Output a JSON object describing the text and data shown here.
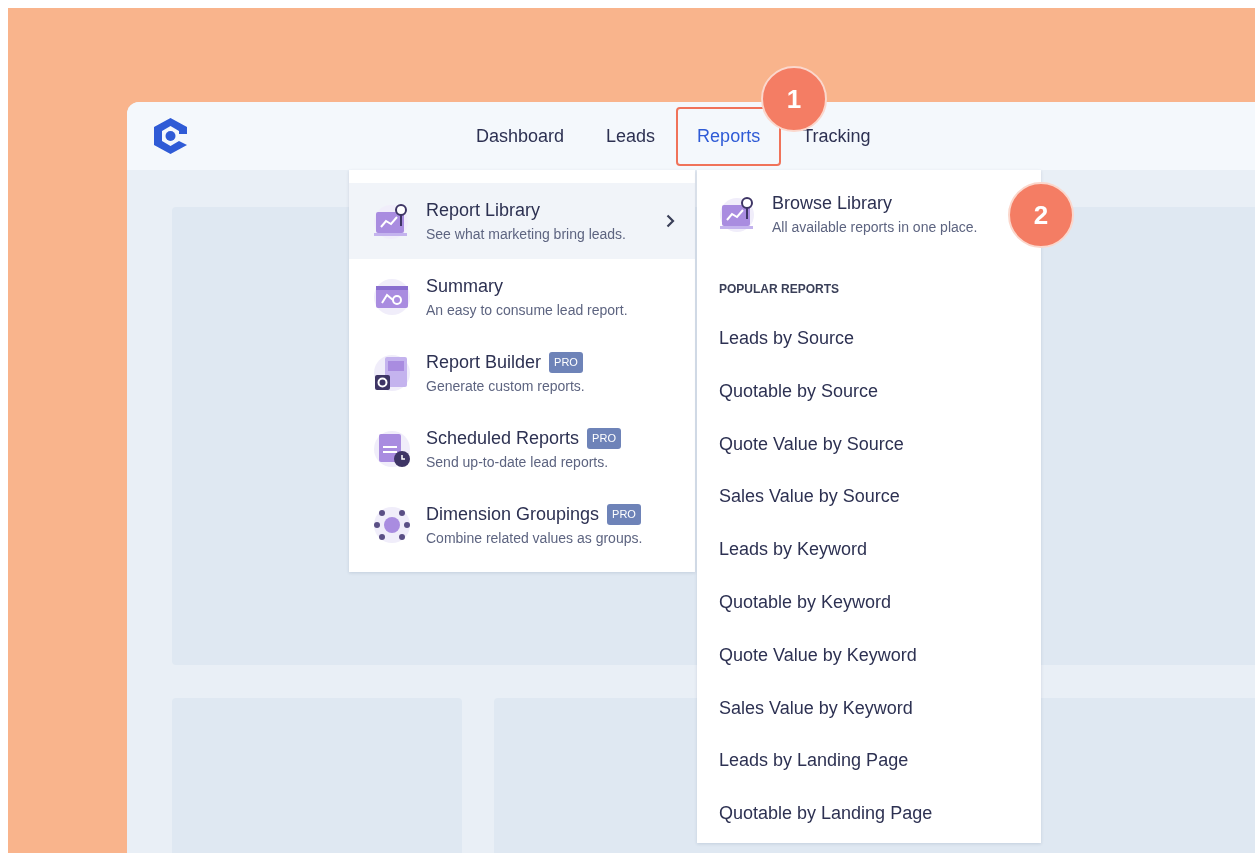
{
  "nav": {
    "items": [
      {
        "label": "Dashboard",
        "selected": false
      },
      {
        "label": "Leads",
        "selected": false
      },
      {
        "label": "Reports",
        "selected": true
      },
      {
        "label": "Tracking",
        "selected": false
      }
    ]
  },
  "menu": {
    "items": [
      {
        "title": "Report Library",
        "description": "See what marketing bring leads.",
        "selected": true,
        "has_submenu": true
      },
      {
        "title": "Summary",
        "description": "An easy to consume lead report.",
        "selected": false,
        "has_submenu": false
      },
      {
        "title": "Report Builder",
        "description": "Generate custom reports.",
        "badge": "PRO",
        "selected": false,
        "has_submenu": false
      },
      {
        "title": "Scheduled Reports",
        "description": "Send up-to-date lead reports.",
        "badge": "PRO",
        "selected": false,
        "has_submenu": false
      },
      {
        "title": "Dimension Groupings",
        "description": "Combine related values as groups.",
        "badge": "PRO",
        "selected": false,
        "has_submenu": false
      }
    ]
  },
  "submenu": {
    "header": {
      "title": "Browse Library",
      "description": "All available reports in one place."
    },
    "section_label": "POPULAR REPORTS",
    "links": [
      "Leads by Source",
      "Quotable by Source",
      "Quote Value by Source",
      "Sales Value by Source",
      "Leads by Keyword",
      "Quotable by Keyword",
      "Quote Value by Keyword",
      "Sales Value by Keyword",
      "Leads by Landing Page",
      "Quotable by Landing Page"
    ]
  },
  "callouts": [
    "1",
    "2"
  ]
}
